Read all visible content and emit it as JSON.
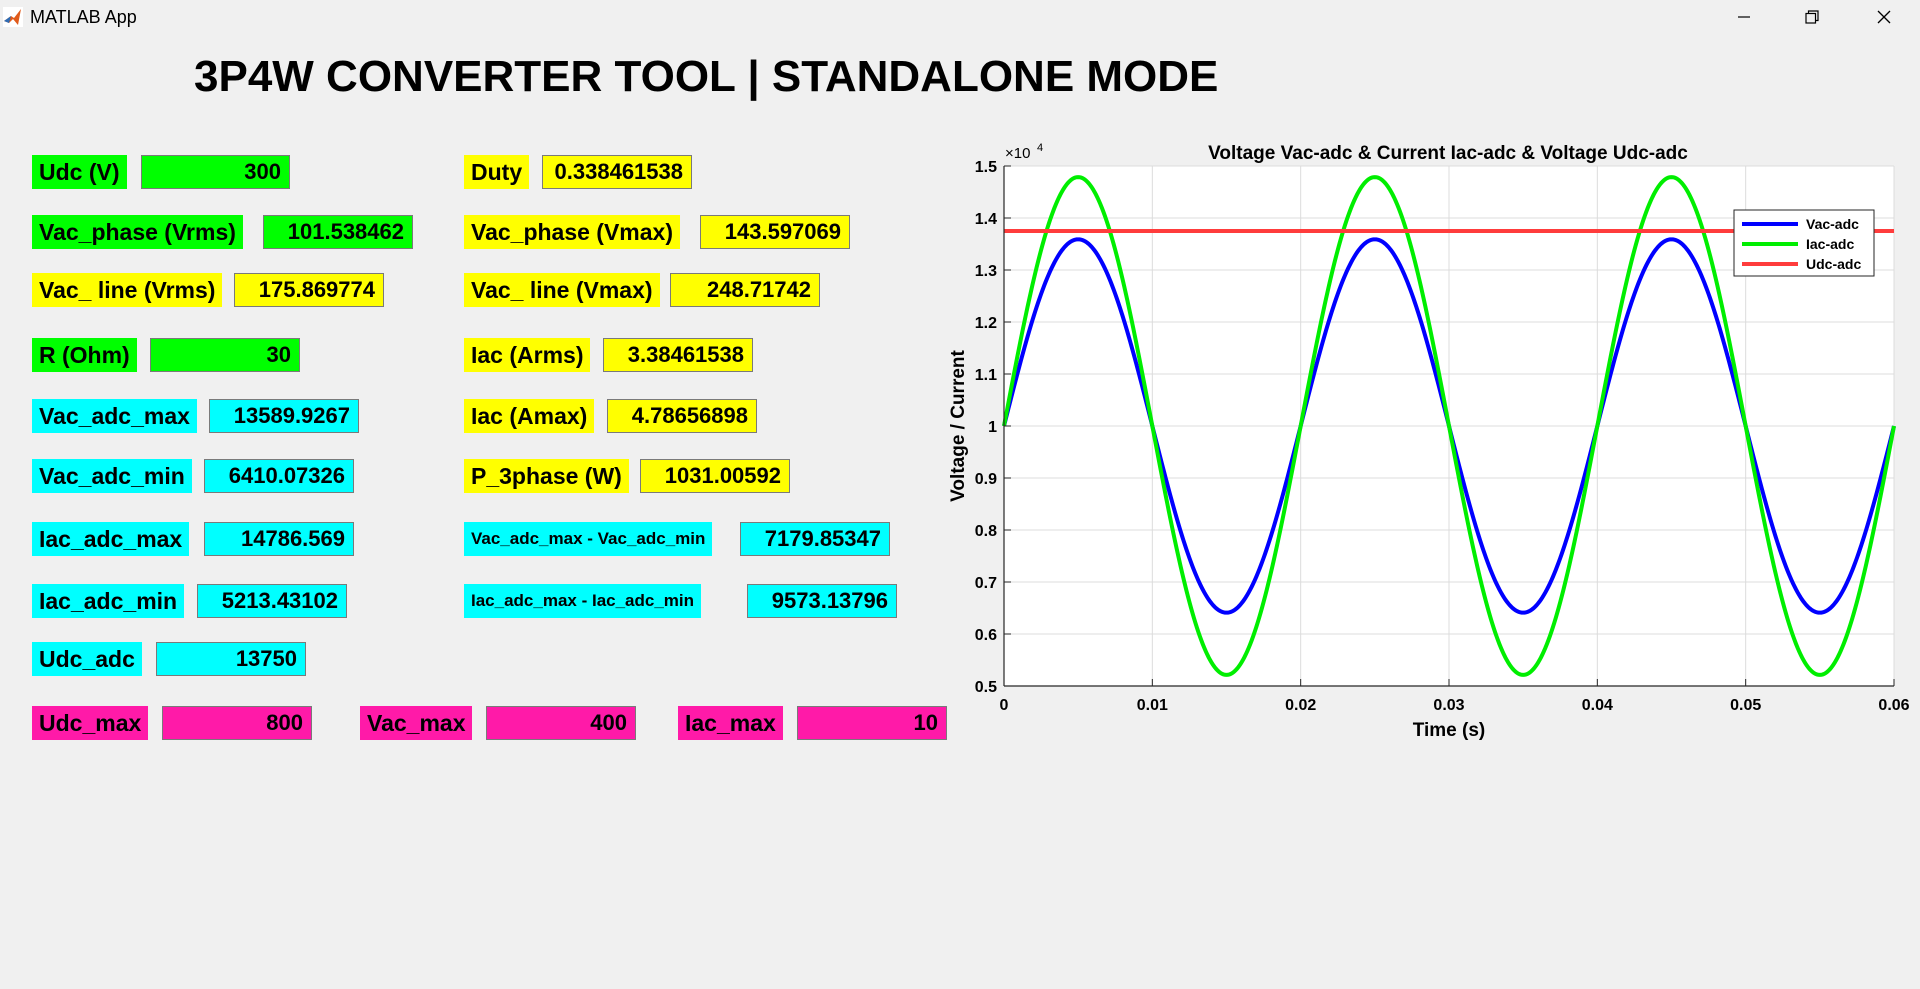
{
  "window": {
    "title": "MATLAB App",
    "controls": [
      "minimize-icon",
      "restore-icon",
      "close-icon"
    ]
  },
  "page_title": "3P4W CONVERTER TOOL | STANDALONE MODE",
  "colors": {
    "green": "#00ff00",
    "yellow": "#ffff00",
    "cyan": "#00ffff",
    "magenta": "#ff1aa8",
    "vac": "#0000ff",
    "iac": "#00ee00",
    "udc": "#ff3c3c"
  },
  "fields": {
    "udc_v": {
      "label": "Udc (V)",
      "value": "300"
    },
    "vac_phase_vrms": {
      "label": "Vac_phase (Vrms)",
      "value": "101.538462"
    },
    "vac_line_vrms": {
      "label": "Vac_ line (Vrms)",
      "value": "175.869774"
    },
    "r_ohm": {
      "label": "R (Ohm)",
      "value": "30"
    },
    "vac_adc_max": {
      "label": "Vac_adc_max",
      "value": "13589.9267"
    },
    "vac_adc_min": {
      "label": "Vac_adc_min",
      "value": "6410.07326"
    },
    "iac_adc_max": {
      "label": "Iac_adc_max",
      "value": "14786.569"
    },
    "iac_adc_min": {
      "label": "Iac_adc_min",
      "value": "5213.43102"
    },
    "udc_adc": {
      "label": "Udc_adc",
      "value": "13750"
    },
    "duty": {
      "label": "Duty",
      "value": "0.338461538"
    },
    "vac_phase_vmax": {
      "label": "Vac_phase (Vmax)",
      "value": "143.597069"
    },
    "vac_line_vmax": {
      "label": "Vac_ line (Vmax)",
      "value": "248.71742"
    },
    "iac_arms": {
      "label": "Iac (Arms)",
      "value": "3.38461538"
    },
    "iac_amax": {
      "label": "Iac (Amax)",
      "value": "4.78656898"
    },
    "p_3phase": {
      "label": "P_3phase (W)",
      "value": "1031.00592"
    },
    "vac_span": {
      "label": "Vac_adc_max - Vac_adc_min",
      "value": "7179.85347"
    },
    "iac_span": {
      "label": "Iac_adc_max - Iac_adc_min",
      "value": "9573.13796"
    },
    "udc_max": {
      "label": "Udc_max",
      "value": "800"
    },
    "vac_max": {
      "label": "Vac_max",
      "value": "400"
    },
    "iac_max": {
      "label": "Iac_max",
      "value": "10"
    }
  },
  "chart_data": {
    "type": "line",
    "title": "Voltage Vac-adc & Current Iac-adc & Voltage Udc-adc",
    "xlabel": "Time (s)",
    "ylabel": "Voltage / Current",
    "y_exponent_label": "×10",
    "y_exponent": "4",
    "xlim": [
      0,
      0.06
    ],
    "ylim": [
      5000,
      15000
    ],
    "x_ticks": [
      "0",
      "0.01",
      "0.02",
      "0.03",
      "0.04",
      "0.05",
      "0.06"
    ],
    "y_ticks": [
      "0.5",
      "0.6",
      "0.7",
      "0.8",
      "0.9",
      "1",
      "1.1",
      "1.2",
      "1.3",
      "1.4",
      "1.5"
    ],
    "grid": true,
    "legend_position": "top-right",
    "series": [
      {
        "name": "Vac-adc",
        "kind": "sine",
        "offset": 10000,
        "amplitude": 3589.9267,
        "frequency_hz": 50,
        "color": "#0000ff"
      },
      {
        "name": "Iac-adc",
        "kind": "sine",
        "offset": 10000,
        "amplitude": 4786.569,
        "frequency_hz": 50,
        "color": "#00ee00"
      },
      {
        "name": "Udc-adc",
        "kind": "constant",
        "value": 13750,
        "color": "#ff3c3c"
      }
    ]
  }
}
